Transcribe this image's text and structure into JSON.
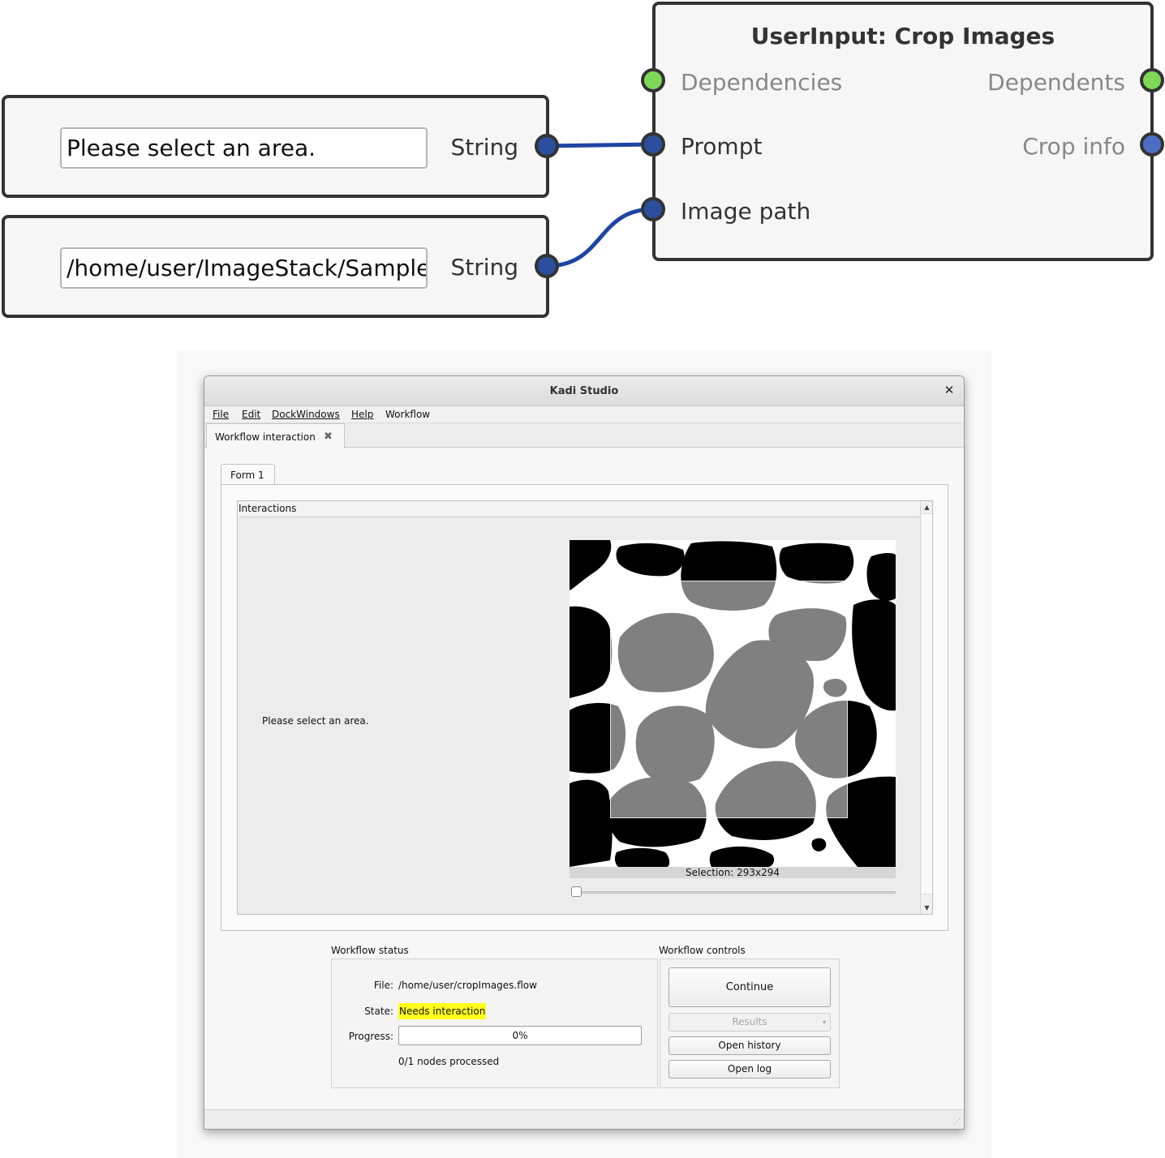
{
  "graph": {
    "string_node_1": {
      "value": "Please select an area.",
      "out_label": "String"
    },
    "string_node_2": {
      "value": "/home/user/ImageStack/Samples",
      "out_label": "String"
    },
    "crop_node": {
      "title": "UserInput: Crop Images",
      "inputs": [
        "Dependencies",
        "Prompt",
        "Image path"
      ],
      "outputs": [
        "Dependents",
        "Crop info"
      ]
    }
  },
  "window": {
    "title": "Kadi Studio",
    "menu": [
      "File",
      "Edit",
      "DockWindows",
      "Help",
      "Workflow"
    ],
    "doc_tab": "Workflow interaction",
    "form_tab": "Form 1",
    "interactions": {
      "title": "Interactions",
      "prompt": "Please select an area.",
      "selection_label": "Selection: 293x294"
    },
    "status": {
      "title": "Workflow status",
      "file_key": "File:",
      "file_value": "/home/user/cropImages.flow",
      "state_key": "State:",
      "state_value": "Needs interaction",
      "progress_key": "Progress:",
      "progress_value": "0%",
      "nodes_processed": "0/1 nodes processed"
    },
    "controls": {
      "title": "Workflow controls",
      "continue": "Continue",
      "results": "Results",
      "open_history": "Open history",
      "open_log": "Open log"
    }
  },
  "colors": {
    "wire": "#1f45a3",
    "port_blue": "#2b4f9e",
    "port_green": "#7ed957",
    "state_highlight": "#ffff1a"
  }
}
